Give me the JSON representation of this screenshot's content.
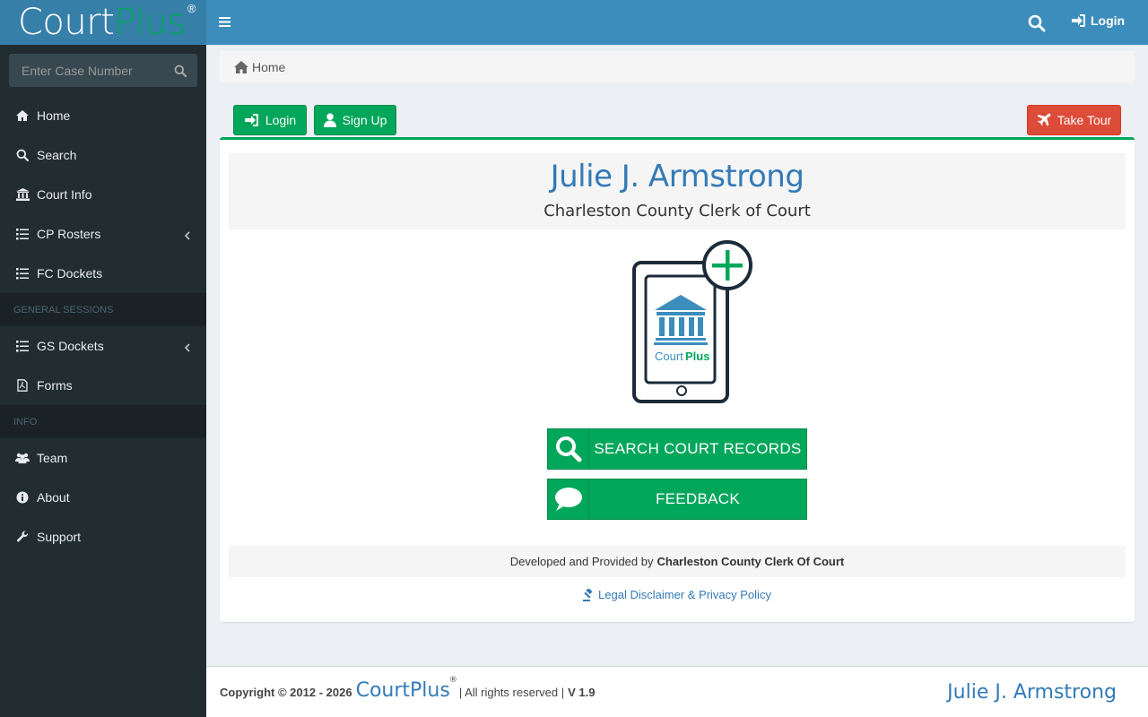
{
  "brand": {
    "court": "Court",
    "plus": "Plus",
    "registered": "®"
  },
  "sidebar": {
    "search_placeholder": "Enter Case Number",
    "items": [
      {
        "label": "Home",
        "icon": "home-icon"
      },
      {
        "label": "Search",
        "icon": "search-icon"
      },
      {
        "label": "Court Info",
        "icon": "bank-icon"
      },
      {
        "label": "CP Rosters",
        "icon": "list-icon",
        "expandable": true
      },
      {
        "label": "FC Dockets",
        "icon": "list-icon"
      }
    ],
    "header_general_sessions": "GENERAL SESSIONS",
    "gs_items": [
      {
        "label": "GS Dockets",
        "icon": "list-icon",
        "expandable": true
      },
      {
        "label": "Forms",
        "icon": "pdf-icon"
      }
    ],
    "header_info": "INFO",
    "info_items": [
      {
        "label": "Team",
        "icon": "users-icon"
      },
      {
        "label": "About",
        "icon": "info-icon"
      },
      {
        "label": "Support",
        "icon": "wrench-icon"
      }
    ]
  },
  "topbar": {
    "login_label": "Login"
  },
  "breadcrumb": {
    "home": "Home"
  },
  "actions": {
    "login": "Login",
    "signup": "Sign Up",
    "tour": "Take Tour"
  },
  "hero": {
    "name": "Julie J. Armstrong",
    "office": "Charleston County Clerk of Court"
  },
  "device_logo": {
    "court": "Court",
    "plus": "Plus"
  },
  "buttons": {
    "search_records": "SEARCH COURT RECORDS",
    "feedback": "FEEDBACK"
  },
  "dev_note": {
    "prefix": "Developed and Provided by",
    "org": "Charleston County Clerk Of Court"
  },
  "disclaimer": "Legal Disclaimer & Privacy Policy",
  "footer": {
    "copyright": "Copyright © 2012 - 2026",
    "brand": "CourtPlus",
    "registered": "®",
    "rights": "| All rights reserved |",
    "version": "V 1.9",
    "right_name": "Julie J. Armstrong"
  },
  "colors": {
    "primary": "#3c8dbc",
    "logo_bg": "#367fa9",
    "sidebar_bg": "#222d32",
    "success": "#00a65a",
    "danger": "#dd4b39",
    "link": "#337ab7"
  }
}
